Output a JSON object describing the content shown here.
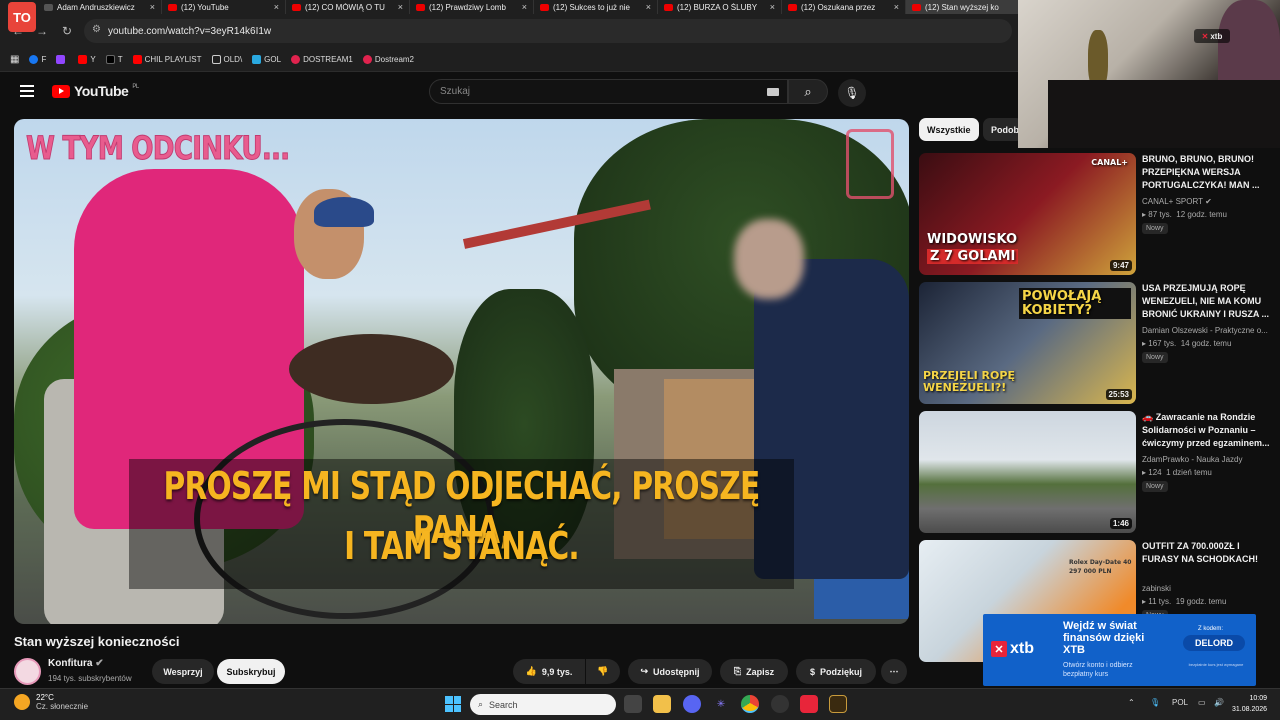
{
  "browser": {
    "app_logo": "TO",
    "tabs": [
      {
        "title": "Adam Andruszkiewicz",
        "active": false
      },
      {
        "title": "(12) YouTube",
        "active": false
      },
      {
        "title": "(12) CO MÓWIĄ O TU",
        "active": false
      },
      {
        "title": "(12) Prawdziwy Lomb",
        "active": false
      },
      {
        "title": "(12) Sukces to już nie",
        "active": false
      },
      {
        "title": "(12) BURZA O ŚLUBY",
        "active": false
      },
      {
        "title": "(12) Oszukana przez",
        "active": false
      },
      {
        "title": "(12) Stan wyższej ko",
        "active": true
      }
    ],
    "close_glyph": "×",
    "url": "youtube.com/watch?v=3eyR14k6I1w",
    "bookmarks": [
      {
        "label": "F",
        "color": "#1877f2"
      },
      {
        "label": "",
        "color": "#9146ff"
      },
      {
        "label": "Y",
        "color": "#ff0000"
      },
      {
        "label": "T",
        "color": "#000000"
      },
      {
        "label": "CHIL PLAYLIST",
        "color": "#ff0000"
      },
      {
        "label": "OLD\\",
        "color": "#888888"
      },
      {
        "label": "GOL",
        "color": "#2aa9e0"
      },
      {
        "label": "DOSTREAM1",
        "color": "#e0234e"
      },
      {
        "label": "Dostream2",
        "color": "#e0234e"
      }
    ]
  },
  "youtube": {
    "logo_text": "YouTube",
    "logo_region": "PL",
    "search_placeholder": "Szukaj",
    "search_icon": "⌕",
    "mic_icon": "🎙"
  },
  "video": {
    "overlay_tag": "W TYM ODCINKU...",
    "subtitle_line1": "PROSZĘ MI STĄD ODJECHAĆ, PROSZĘ PANA,",
    "subtitle_line2": "I TAM STANĄĆ.",
    "title": "Stan wyższej konieczności",
    "channel": "Konfitura",
    "subscribers": "194 tys. subskrybentów",
    "support_label": "Wesprzyj",
    "subscribe_label": "Subskrybuj",
    "likes": "9,9 tys.",
    "share_label": "Udostępnij",
    "save_label": "Zapisz",
    "thanks_label": "Podziękuj",
    "more_glyph": "⋯"
  },
  "sidebar": {
    "chips": [
      "Wszystkie",
      "Podob"
    ],
    "cards": [
      {
        "title": "BRUNO, BRUNO, BRUNO! PRZEPIĘKNA WERSJA PORTUGALCZYKA! MAN ...",
        "channel": "CANAL+ SPORT",
        "views": "87 tys.",
        "age": "12 godz. temu",
        "badge": "Nowy",
        "duration": "9:47",
        "thumb_text1": "WIDOWISKO",
        "thumb_text2": "Z 7 GOLAMI",
        "thumb_brand": "CANAL+"
      },
      {
        "title": "USA PRZEJMUJĄ ROPĘ WENEZUELI, NIE MA KOMU BRONIĆ UKRAINY I RUSZA ...",
        "channel": "Damian Olszewski - Praktyczne o...",
        "views": "167 tys.",
        "age": "14 godz. temu",
        "badge": "Nowy",
        "duration": "25:53",
        "thumb_text1": "POWOŁAJĄ KOBIETY?",
        "thumb_text2": "PRZEJĘLI ROPĘ WENEZUELI?!"
      },
      {
        "title": "🚗 Zawracanie na Rondzie Solidarności w Poznaniu – ćwiczymy przed egzaminem...",
        "channel": "ZdamPrawko - Nauka Jazdy",
        "views": "124",
        "age": "1 dzień temu",
        "badge": "Nowy",
        "duration": "1:46"
      },
      {
        "title": "OUTFIT ZA 700.000ZŁ I FURASY NA SCHODKACH!",
        "channel": "zabinski",
        "views": "11 tys.",
        "age": "19 godz. temu",
        "badge": "Nowy",
        "duration": "",
        "thumb_text1": "Rolex Day-Date 40",
        "thumb_text2": "297 000 PLN"
      }
    ]
  },
  "webcam": {
    "badge": "xtb"
  },
  "ad": {
    "logo": "xtb",
    "title": "Wejdź w świat finansów dzięki XTB",
    "subtitle": "Otwórz konto i odbierz bezpłatny kurs",
    "code_label": "Z kodem:",
    "code": "DELORD",
    "note": "bezpłatnie kurs jest wymagane"
  },
  "taskbar": {
    "temperature": "22°C",
    "weather": "Cz. słonecznie",
    "search_placeholder": "Search",
    "language": "POL",
    "time": "10:09",
    "date": "31.08.2026"
  }
}
